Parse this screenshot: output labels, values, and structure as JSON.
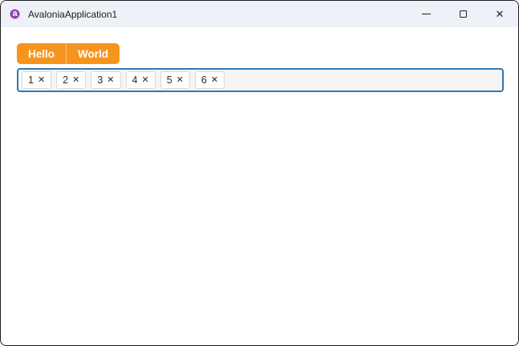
{
  "window": {
    "title": "AvaloniaApplication1",
    "logo_letter": "a"
  },
  "titlebar_controls": {
    "minimize_icon": "minimize-icon",
    "maximize_icon": "maximize-icon",
    "close_icon": "close-icon",
    "close_glyph": "✕"
  },
  "toolbar": {
    "hello_label": "Hello",
    "world_label": "World"
  },
  "tags_input": {
    "items": [
      "1",
      "2",
      "3",
      "4",
      "5",
      "6"
    ],
    "remove_glyph": "✕"
  },
  "colors": {
    "accent_orange": "#F7941E",
    "focus_border_blue": "#2E79B5",
    "titlebar_bg": "#EEF2F8",
    "logo_purple": "#8B44AC"
  }
}
